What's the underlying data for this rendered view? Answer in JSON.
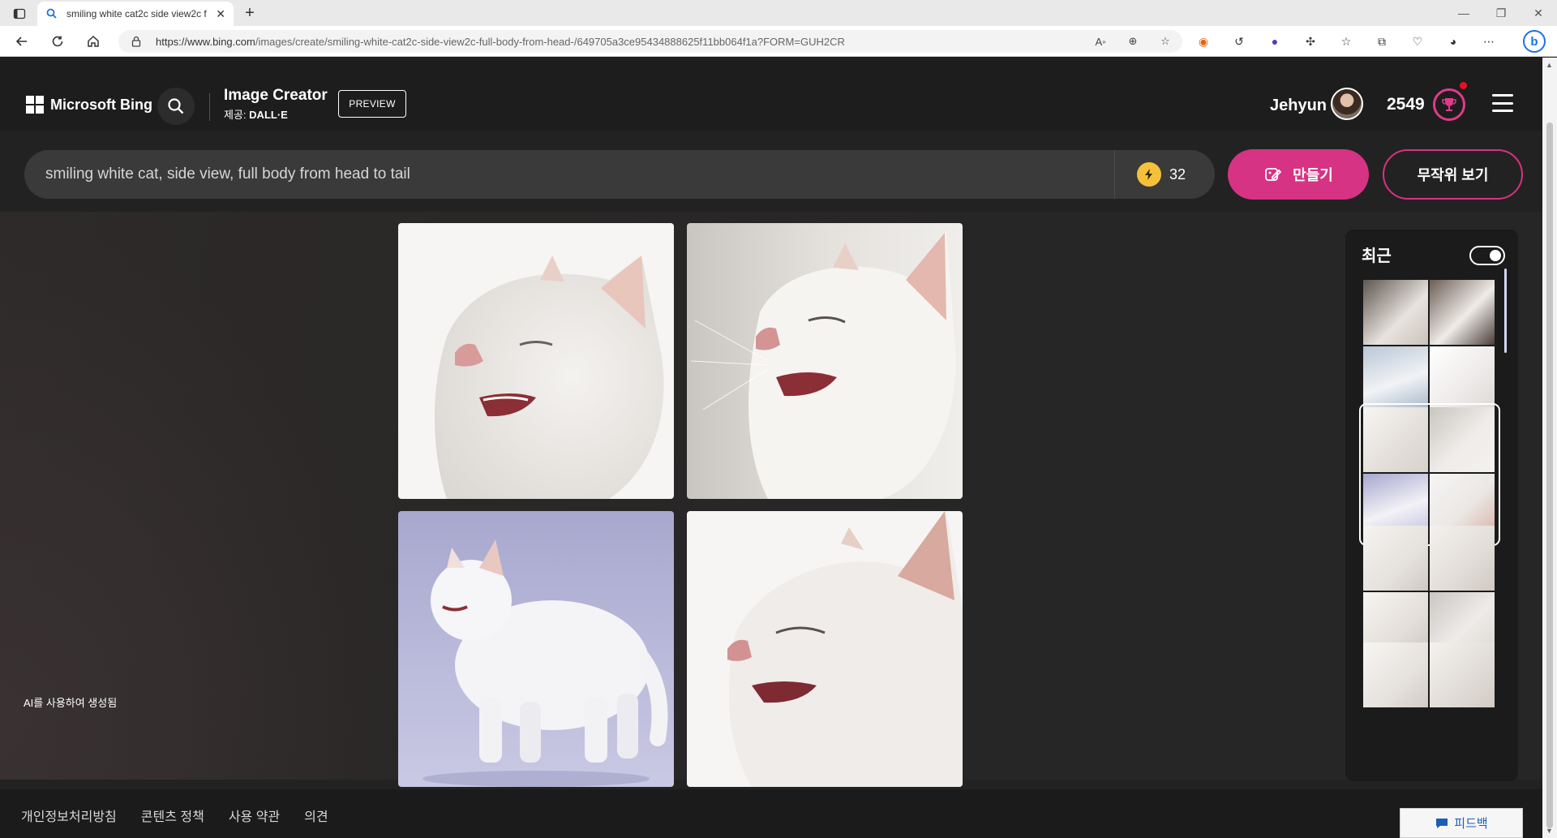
{
  "browser": {
    "tab_title": "smiling white cat2c side view2c f",
    "url_host": "https://www.bing.com",
    "url_path": "/images/create/smiling-white-cat2c-side-view2c-full-body-from-head-/649705a3ce95434888625f11bb064f1a?FORM=GUH2CR",
    "ext_b_label": "b"
  },
  "header": {
    "logo_text": "Microsoft Bing",
    "product_title": "Image Creator",
    "provider_prefix": "제공:",
    "provider_name": "DALL·E",
    "preview_label": "PREVIEW",
    "user_name": "Jehyun",
    "points": "2549"
  },
  "prompt": {
    "text": "smiling white cat, side view, full body from head to tail",
    "boost_count": "32",
    "create_label": "만들기",
    "random_label": "무작위 보기"
  },
  "images": [
    {
      "alt": "smiling white cat close-up side profile"
    },
    {
      "alt": "smiling white cat with whiskers side profile"
    },
    {
      "alt": "full body white cat side view on lavender background"
    },
    {
      "alt": "white cat side profile eyes closed"
    }
  ],
  "ai_generated_label": "AI를 사용하여 생성됨",
  "recent": {
    "title": "최근",
    "toggle_on": true
  },
  "footer": {
    "links": [
      "개인정보처리방침",
      "콘텐츠 정책",
      "사용 약관",
      "의견"
    ],
    "feedback_label": "피드백"
  },
  "colors": {
    "accent_pink": "#d63384",
    "boost_yellow": "#f5c13b",
    "page_bg": "#232222"
  }
}
